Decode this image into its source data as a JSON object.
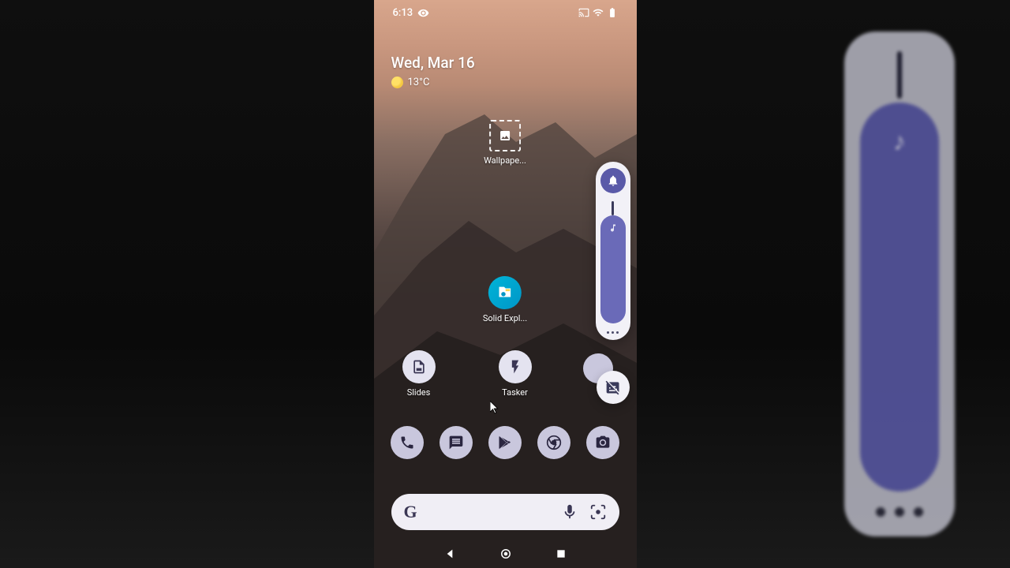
{
  "status": {
    "time": "6:13",
    "icons": [
      "eye-icon",
      "cast-icon",
      "wifi-icon",
      "battery-icon"
    ]
  },
  "widget": {
    "date": "Wed, Mar 16",
    "temperature": "13°C"
  },
  "apps": {
    "wallpaper": {
      "label": "Wallpape..."
    },
    "solid": {
      "label": "Solid Expl..."
    },
    "slides": {
      "label": "Slides"
    },
    "tasker": {
      "label": "Tasker"
    }
  },
  "favorites": [
    "phone",
    "messages",
    "play-store",
    "chrome",
    "camera"
  ],
  "search": {
    "logo": "G"
  },
  "volume": {
    "mode": "ring",
    "level_percent": 90
  },
  "colors": {
    "accent": "#5a5aa8",
    "icon_bg": "#c9c7dd",
    "panel_bg": "#f2f1f7"
  }
}
